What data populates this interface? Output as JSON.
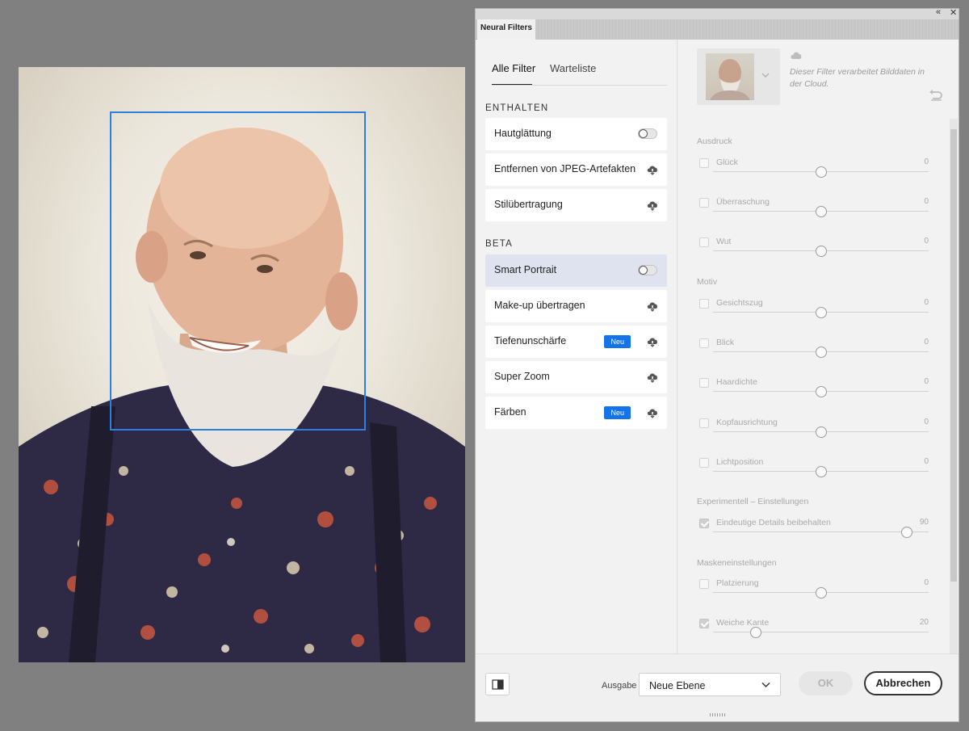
{
  "window": {
    "panel_title": "Neural Filters",
    "collapse_glyph": "«",
    "close_glyph": "✕"
  },
  "filter_tabs": [
    {
      "label": "Alle Filter",
      "active": true
    },
    {
      "label": "Warteliste",
      "active": false
    }
  ],
  "sections": {
    "included": "ENTHALTEN",
    "beta": "BETA"
  },
  "filters_included": [
    {
      "label": "Hautglättung",
      "control": "toggle",
      "on": false
    },
    {
      "label": "Entfernen von JPEG-Artefakten",
      "control": "cloud-download-icon"
    },
    {
      "label": "Stilübertragung",
      "control": "cloud-download-icon"
    }
  ],
  "filters_beta": [
    {
      "label": "Smart Portrait",
      "control": "toggle",
      "on": false,
      "selected": true
    },
    {
      "label": "Make-up übertragen",
      "control": "cloud-download-icon"
    },
    {
      "label": "Tiefenunschärfe",
      "control": "cloud-download-icon",
      "badge": "Neu"
    },
    {
      "label": "Super Zoom",
      "control": "cloud-download-icon"
    },
    {
      "label": "Färben",
      "control": "cloud-download-icon",
      "badge": "Neu"
    }
  ],
  "preview": {
    "cloud_note": "Dieser Filter verarbeitet Bilddaten in der Cloud."
  },
  "settings": {
    "group_expression": "Ausdruck",
    "group_motif": "Motiv",
    "group_experimental": "Experimentell – Einstellungen",
    "group_mask": "Maskeneinstellungen",
    "expression": [
      {
        "label": "Glück",
        "value": "0",
        "checked": false,
        "level": 0.5
      },
      {
        "label": "Überraschung",
        "value": "0",
        "checked": false,
        "level": 0.5
      },
      {
        "label": "Wut",
        "value": "0",
        "checked": false,
        "level": 0.5
      }
    ],
    "motif": [
      {
        "label": "Gesichtszug",
        "value": "0",
        "checked": false,
        "level": 0.5
      },
      {
        "label": "Blick",
        "value": "0",
        "checked": false,
        "level": 0.5
      },
      {
        "label": "Haardichte",
        "value": "0",
        "checked": false,
        "level": 0.5
      },
      {
        "label": "Kopfausrichtung",
        "value": "0",
        "checked": false,
        "level": 0.5
      },
      {
        "label": "Lichtposition",
        "value": "0",
        "checked": false,
        "level": 0.5
      }
    ],
    "experimental": [
      {
        "label": "Eindeutige Details beibehalten",
        "value": "90",
        "checked": true,
        "level": 0.9
      }
    ],
    "mask": [
      {
        "label": "Platzierung",
        "value": "0",
        "checked": false,
        "level": 0.5
      },
      {
        "label": "Weiche Kante",
        "value": "20",
        "checked": true,
        "level": 0.2
      }
    ]
  },
  "footer": {
    "output_label": "Ausgabe",
    "output_value": "Neue Ebene",
    "ok_label": "OK",
    "cancel_label": "Abbrechen"
  },
  "colors": {
    "selection_blue": "#2f7fe3",
    "badge_blue": "#1473e6",
    "selected_row": "#dfe3ef"
  }
}
